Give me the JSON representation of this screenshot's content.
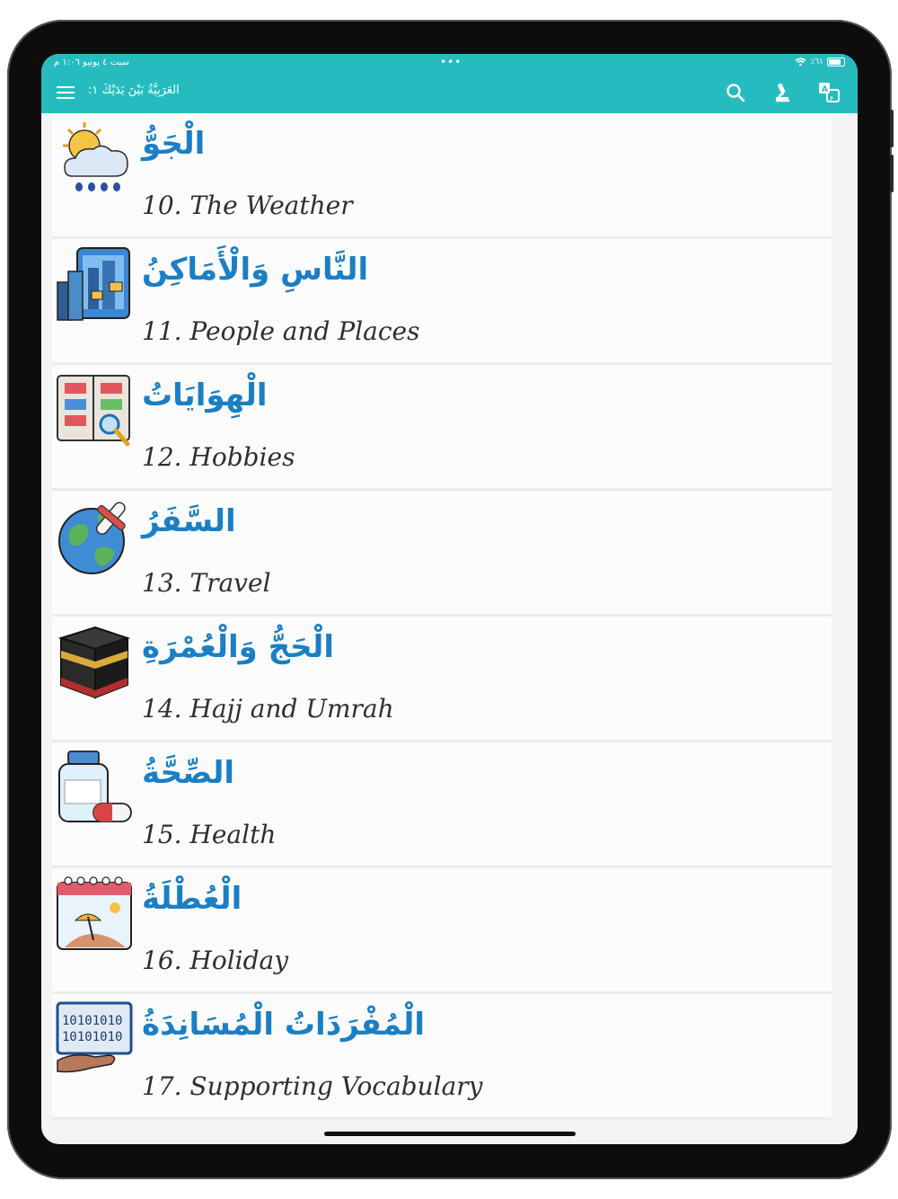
{
  "status_bar": {
    "left": "سبت ٤ يونيو ١:٠٦ م",
    "dots": "•••",
    "battery_text": "٪٦١"
  },
  "toolbar": {
    "title": "العَرَبِيَّةُ بَيْنَ يَدَيْكَ ١:",
    "icons": [
      "menu-icon",
      "search-icon",
      "microscope-icon",
      "translate-icon"
    ]
  },
  "lessons": [
    {
      "arabic": "الْجَوُّ",
      "english": "10. The Weather",
      "icon": "weather-icon"
    },
    {
      "arabic": "النَّاسِ وَالْأَمَاكِنُ",
      "english": "11. People and Places",
      "icon": "city-icon"
    },
    {
      "arabic": "الْهِوَايَاتُ",
      "english": "12. Hobbies",
      "icon": "hobbies-book-icon"
    },
    {
      "arabic": "السَّفَرُ",
      "english": "13. Travel",
      "icon": "globe-plane-icon"
    },
    {
      "arabic": "الْحَجُّ وَالْعُمْرَةِ",
      "english": "14. Hajj and Umrah",
      "icon": "kaaba-icon"
    },
    {
      "arabic": "الصِّحَّةُ",
      "english": "15. Health",
      "icon": "medicine-icon"
    },
    {
      "arabic": "الْعُطْلَةُ",
      "english": "16. Holiday",
      "icon": "calendar-beach-icon"
    },
    {
      "arabic": "الْمُفْرَدَاتُ الْمُسَانِدَةُ",
      "english": "17. Supporting Vocabulary",
      "icon": "binary-hand-icon"
    }
  ],
  "colors": {
    "toolbar": "#26bcbf",
    "arabic_text": "#1a7fc4",
    "english_text": "#2f2f2f"
  }
}
